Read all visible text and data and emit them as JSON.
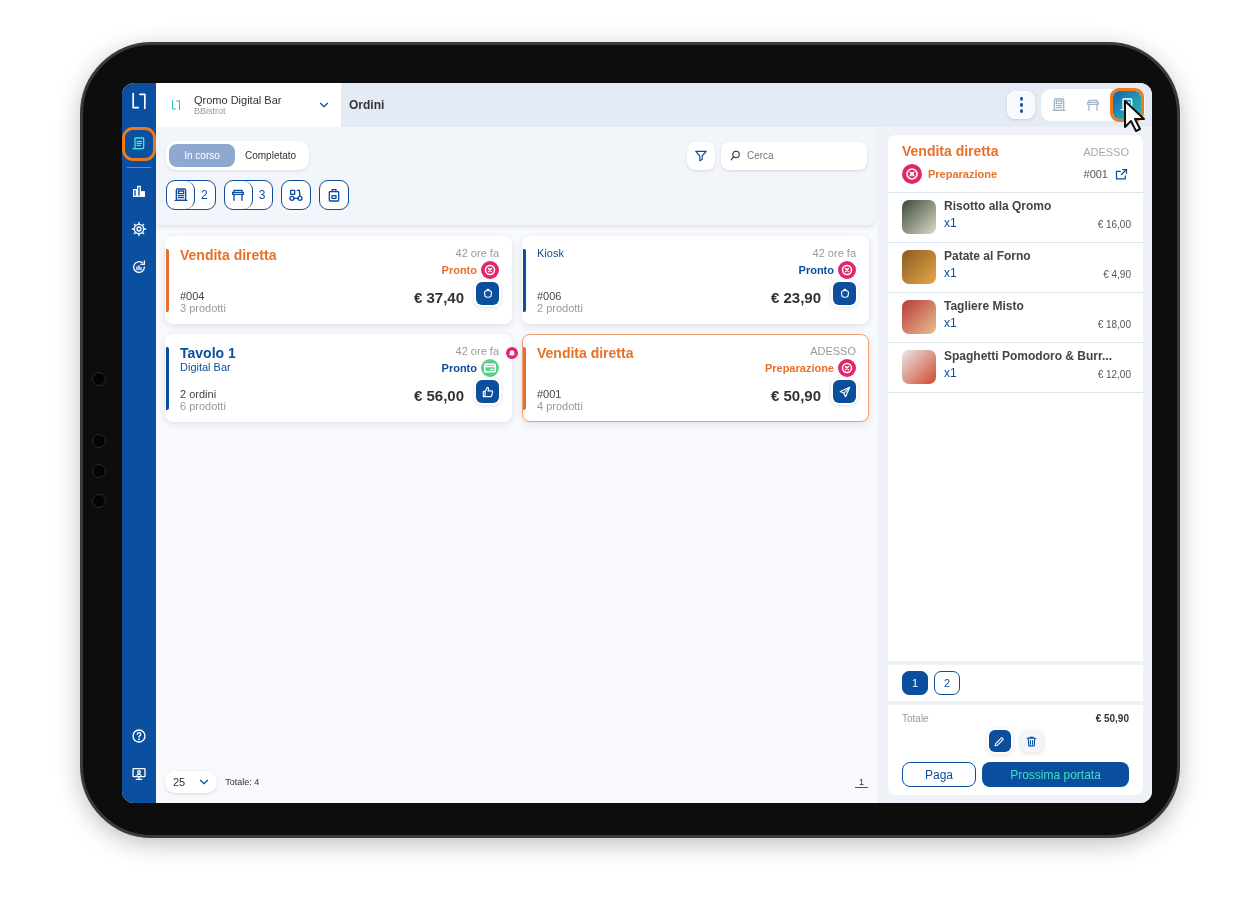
{
  "sidebar": {
    "items": [
      {
        "kind": "orders",
        "selected": true
      },
      {
        "kind": "stats",
        "selected": false
      },
      {
        "kind": "settings",
        "selected": false
      },
      {
        "kind": "reports",
        "selected": false
      }
    ],
    "bottom_items": [
      {
        "kind": "help",
        "selected": false
      },
      {
        "kind": "display",
        "selected": false
      }
    ]
  },
  "topbar": {
    "venue": "Qromo Digital Bar",
    "venue_subtitle": "BBistrot",
    "title": "Ordini",
    "views": [
      {
        "kind": "register",
        "selected": false
      },
      {
        "kind": "table",
        "selected": false
      },
      {
        "kind": "orders",
        "selected": true
      }
    ]
  },
  "filters": {
    "status_tabs": [
      {
        "label": "In corso",
        "selected": true
      },
      {
        "label": "Completato",
        "selected": false
      }
    ],
    "search": {
      "placeholder": "Cerca"
    },
    "channels": [
      {
        "kind": "register",
        "count": "2"
      },
      {
        "kind": "table",
        "count": "3"
      },
      {
        "kind": "delivery"
      },
      {
        "kind": "takeaway"
      }
    ]
  },
  "orders": [
    {
      "title": "Vendita diretta",
      "color": "#e8702a",
      "time": "42 ore fa",
      "status": {
        "label": "Pronto",
        "kind": "cancel"
      },
      "number": "#004",
      "products": "3 prodotti",
      "total": "€ 37,40",
      "action": {
        "kind": "bag"
      },
      "selected": false,
      "alert": false
    },
    {
      "subtitle": "Kiosk",
      "color": "#0b4e9e",
      "time": "42 ore fa",
      "status": {
        "label": "Pronto",
        "kind": "cancel"
      },
      "number": "#006",
      "products": "2 prodotti",
      "total": "€ 23,90",
      "action": {
        "kind": "bag"
      },
      "selected": false,
      "alert": false
    },
    {
      "title": "Tavolo 1",
      "subtitle": "Digital Bar",
      "color": "#0b4e9e",
      "time": "42 ore fa",
      "status": {
        "label": "Pronto",
        "kind": "card"
      },
      "number": "2 ordini",
      "products": "6 prodotti",
      "total": "€ 56,00",
      "action": {
        "kind": "thumb"
      },
      "selected": false,
      "alert": true
    },
    {
      "title": "Vendita diretta",
      "color": "#e8702a",
      "time": "ADESSO",
      "status": {
        "label": "Preparazione",
        "kind": "cancel"
      },
      "number": "#001",
      "products": "4 prodotti",
      "total": "€ 50,90",
      "action": {
        "kind": "send"
      },
      "selected": true,
      "alert": false
    }
  ],
  "footer": {
    "page_size": "25",
    "total": "Totale: 4",
    "pages": [
      {
        "label": "1",
        "selected": true
      }
    ]
  },
  "detail": {
    "title": "Vendita diretta",
    "color": "#e8702a",
    "time": "ADESSO",
    "status": {
      "label": "Preparazione",
      "kind": "cancel"
    },
    "number": "#001",
    "items": [
      {
        "name": "Risotto alla Qromo",
        "qty": "x1",
        "price": "€ 16,00"
      },
      {
        "name": "Patate al Forno",
        "qty": "x1",
        "price": "€ 4,90"
      },
      {
        "name": "Tagliere Misto",
        "qty": "x1",
        "price": "€ 18,00"
      },
      {
        "name": "Spaghetti Pomodoro & Burr...",
        "qty": "x1",
        "price": "€ 12,00"
      }
    ],
    "courses": [
      {
        "label": "1",
        "selected": true
      },
      {
        "label": "2",
        "selected": false
      }
    ],
    "total_label": "Totale",
    "total": "€ 50,90",
    "buttons": [
      {
        "label": "Paga",
        "kind": "secondary"
      },
      {
        "label": "Prossima portata",
        "kind": "primary"
      }
    ]
  }
}
